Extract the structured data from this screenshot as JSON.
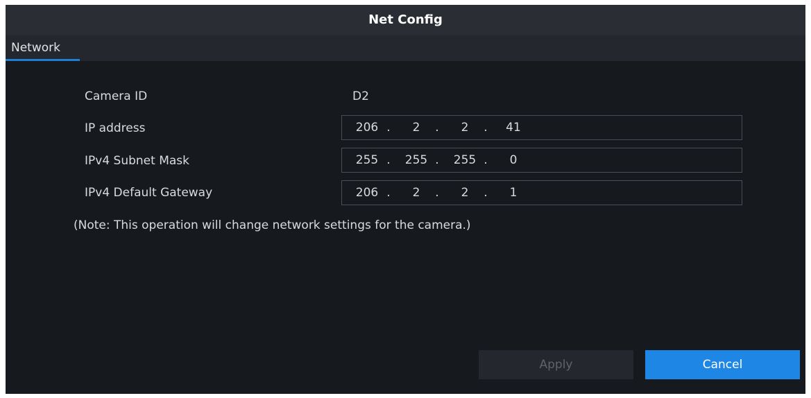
{
  "dialog": {
    "title": "Net Config",
    "tabs": [
      {
        "label": "Network",
        "active": true
      }
    ]
  },
  "form": {
    "camera_id": {
      "label": "Camera ID",
      "value": "D2"
    },
    "ip_address": {
      "label": "IP address",
      "octets": [
        "206",
        "2",
        "2",
        "41"
      ]
    },
    "subnet_mask": {
      "label": "IPv4 Subnet Mask",
      "octets": [
        "255",
        "255",
        "255",
        "0"
      ]
    },
    "gateway": {
      "label": "IPv4 Default Gateway",
      "octets": [
        "206",
        "2",
        "2",
        "1"
      ]
    },
    "separator": "."
  },
  "note": "(Note: This operation will change network settings for the camera.)",
  "buttons": {
    "apply": {
      "label": "Apply",
      "enabled": false
    },
    "cancel": {
      "label": "Cancel",
      "enabled": true
    }
  },
  "colors": {
    "background": "#16191e",
    "titlebar": "#2a2d33",
    "accent": "#1e87e5",
    "tab_underline": "#1f7fd7"
  }
}
